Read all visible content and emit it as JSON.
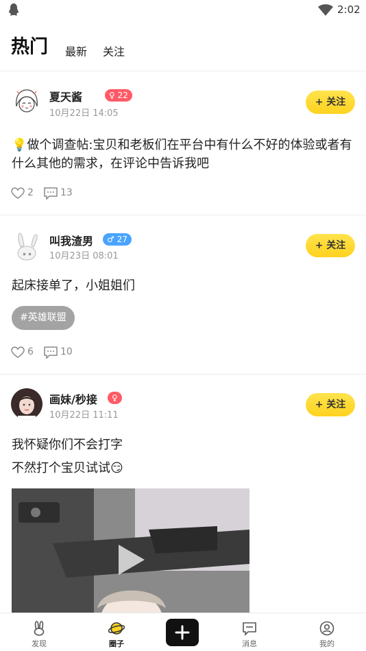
{
  "status_bar": {
    "time": "2:02"
  },
  "tabs": {
    "hot": "热门",
    "latest": "最新",
    "follow": "关注"
  },
  "posts": [
    {
      "username": "夏天酱",
      "gender_badge": "♀ 22",
      "time": "10月22日 14:05",
      "follow_label": "+ 关注",
      "text": "💡做个调查帖:宝贝和老板们在平台中有什么不好的体验或者有什么其他的需求，在评论中告诉我吧",
      "likes": "2",
      "comments": "13"
    },
    {
      "username": "叫我渣男",
      "gender_badge": "♂ 27",
      "time": "10月23日 08:01",
      "follow_label": "+ 关注",
      "text": "起床接单了，小姐姐们",
      "topic": "#英雄联盟",
      "likes": "6",
      "comments": "10"
    },
    {
      "username": "画妹/秒接",
      "gender_badge": "♀",
      "time": "10月22日 11:11",
      "follow_label": "+ 关注",
      "text_line1": "我怀疑你们不会打字",
      "text_line2": "不然打个宝贝试试😏"
    }
  ],
  "bottom_nav": {
    "discover": "发现",
    "circle": "圈子",
    "messages": "消息",
    "mine": "我的"
  },
  "colors": {
    "accent_yellow": "#ffd21f",
    "female_badge": "#ff5a66",
    "male_badge": "#4aa4ff"
  }
}
